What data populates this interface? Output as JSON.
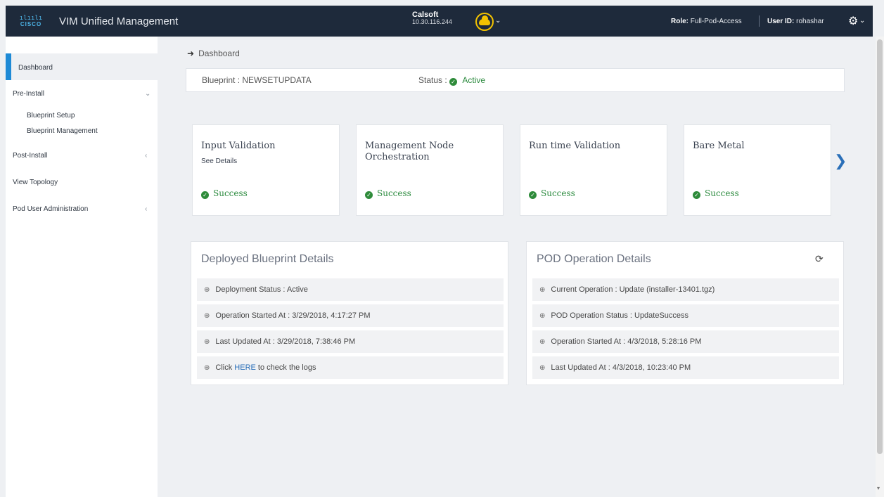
{
  "header": {
    "logo_bars": "ılıılı",
    "logo_text": "CISCO",
    "title": "VIM Unified Management",
    "pod_name": "Calsoft",
    "pod_ip": "10.30.116.244",
    "role_label": "Role:",
    "role_value": "Full-Pod-Access",
    "user_label": "User ID:",
    "user_value": "rohashar"
  },
  "sidebar": {
    "items": [
      {
        "label": "Dashboard"
      },
      {
        "label": "Pre-Install"
      },
      {
        "label": "Blueprint Setup"
      },
      {
        "label": "Blueprint Management"
      },
      {
        "label": "Post-Install"
      },
      {
        "label": "View Topology"
      },
      {
        "label": "Pod User Administration"
      }
    ]
  },
  "breadcrumb": {
    "label": "Dashboard"
  },
  "info": {
    "blueprint": "Blueprint : NEWSETUPDATA",
    "status_label": "Status :",
    "status_value": "Active"
  },
  "cards": [
    {
      "title": "Input Validation",
      "sub": "See Details",
      "result": "Success"
    },
    {
      "title": "Management Node Orchestration",
      "sub": "",
      "result": "Success"
    },
    {
      "title": "Run time Validation",
      "sub": "",
      "result": "Success"
    },
    {
      "title": "Bare Metal",
      "sub": "",
      "result": "Success"
    }
  ],
  "deployed": {
    "title": "Deployed Blueprint Details",
    "rows": [
      "Deployment Status : Active",
      "Operation Started At : 3/29/2018, 4:17:27 PM",
      "Last Updated At : 3/29/2018, 7:38:46 PM"
    ],
    "log_prefix": "Click",
    "log_link": "HERE",
    "log_suffix": "to check the logs"
  },
  "pod_ops": {
    "title": "POD Operation Details",
    "rows": [
      "Current Operation : Update (installer-13401.tgz)",
      "POD Operation Status : UpdateSuccess",
      "Operation Started At : 4/3/2018, 5:28:16 PM",
      "Last Updated At : 4/3/2018, 10:23:40 PM"
    ]
  },
  "colors": {
    "topbar": "#1e2a3b",
    "accent": "#1e8ad6",
    "success": "#2b8a3e",
    "pod_icon": "#f2c200"
  },
  "icons": {
    "breadcrumb": "arrow-right-icon",
    "status": "check-circle-icon",
    "next": "chevron-right-icon",
    "settings": "gear-icon",
    "refresh": "refresh-icon"
  }
}
